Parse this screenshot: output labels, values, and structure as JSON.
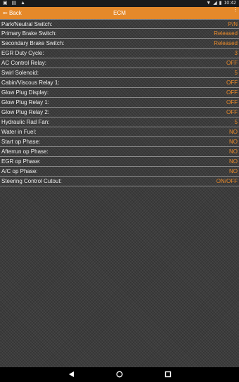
{
  "status": {
    "time": "10:42"
  },
  "appbar": {
    "back_label": "Back",
    "title": "ECM"
  },
  "rows": [
    {
      "label": "Park/Neutral Switch:",
      "value": "P/N"
    },
    {
      "label": "Primary Brake Switch:",
      "value": "Released"
    },
    {
      "label": "Secondary Brake Switch:",
      "value": "Released"
    },
    {
      "label": "EGR Duty Cycle:",
      "value": "3"
    },
    {
      "label": "AC Control Relay:",
      "value": "OFF"
    },
    {
      "label": "Swirl Solenoid:",
      "value": "5"
    },
    {
      "label": "Cabin/Viscous Relay 1:",
      "value": "OFF"
    },
    {
      "label": "Glow Plug Display:",
      "value": "OFF"
    },
    {
      "label": "Glow Plug Relay 1:",
      "value": "OFF"
    },
    {
      "label": "Glow Plug Relay 2:",
      "value": "OFF"
    },
    {
      "label": "Hydraulic Rad Fan:",
      "value": "5"
    },
    {
      "label": "Water in Fuel:",
      "value": "NO"
    },
    {
      "label": "Start op Phase:",
      "value": "NO"
    },
    {
      "label": "Afterrun op Phase:",
      "value": "NO"
    },
    {
      "label": "EGR op Phase:",
      "value": "NO"
    },
    {
      "label": "A/C op Phase:",
      "value": "NO"
    },
    {
      "label": "Steering Control Cutout:",
      "value": "ON/OFF"
    }
  ],
  "colors": {
    "appbar": "#e5892a",
    "value": "#e98a2b",
    "label": "#eeeeee",
    "background": "#3d3d3d"
  },
  "icons": {
    "nav_back": "triangle-back-icon",
    "nav_home": "circle-home-icon",
    "nav_recents": "square-recents-icon"
  }
}
